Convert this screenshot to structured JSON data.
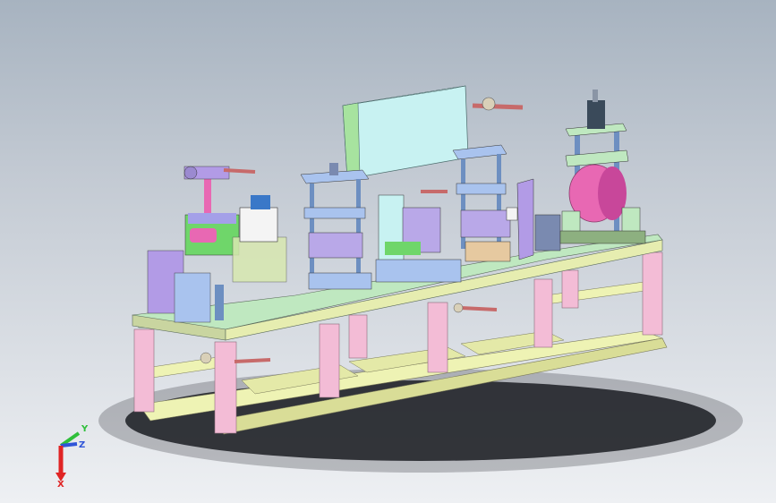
{
  "viewport": {
    "background_top": "#a7b3c0",
    "background_bottom": "#eef0f3",
    "model_colors": {
      "frame_post": "#f3bcd6",
      "frame_rail": "#eef3b4",
      "plate_top": "#bfe8c0",
      "plate_side": "#c9d5a0",
      "control_box": "#c8f2f2",
      "control_box_side": "#a7e39f",
      "die_plate": "#a9c3ee",
      "column": "#6d8fc1",
      "roll": "#e868b3",
      "roll_dark": "#c8479a",
      "rod": "#c76a6a",
      "bracket": "#b29be6",
      "shadow": "#1b1d22"
    }
  },
  "triad": {
    "icon": "coordinate-triad-icon",
    "axes": [
      {
        "name": "Y",
        "color": "#2fbf3a"
      },
      {
        "name": "Z",
        "color": "#2f55d8"
      },
      {
        "name": "X",
        "color": "#e02424"
      }
    ]
  }
}
